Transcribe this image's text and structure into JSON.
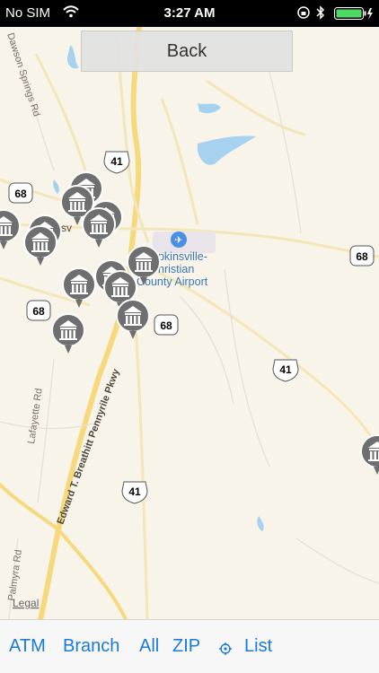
{
  "status": {
    "carrier": "No SIM",
    "time": "3:27 AM"
  },
  "back_label": "Back",
  "map": {
    "airport_label_1": "Hopkinsville-",
    "airport_label_2": "Christian",
    "airport_label_3": "County Airport",
    "road_dawson": "Dawson Springs Rd",
    "road_lafayette": "Lafayette Rd",
    "road_pennyrile": "Edward T. Breathitt Pennyrile Pkwy",
    "road_palmyra": "Palmyra Rd",
    "legal": "Legal",
    "shields": [
      "41",
      "68",
      "68",
      "68",
      "68",
      "41",
      "41"
    ],
    "city_fragment": "o   sv"
  },
  "toolbar": {
    "atm": "ATM",
    "branch": "Branch",
    "all": "All",
    "zip": "ZIP",
    "list": "List"
  }
}
